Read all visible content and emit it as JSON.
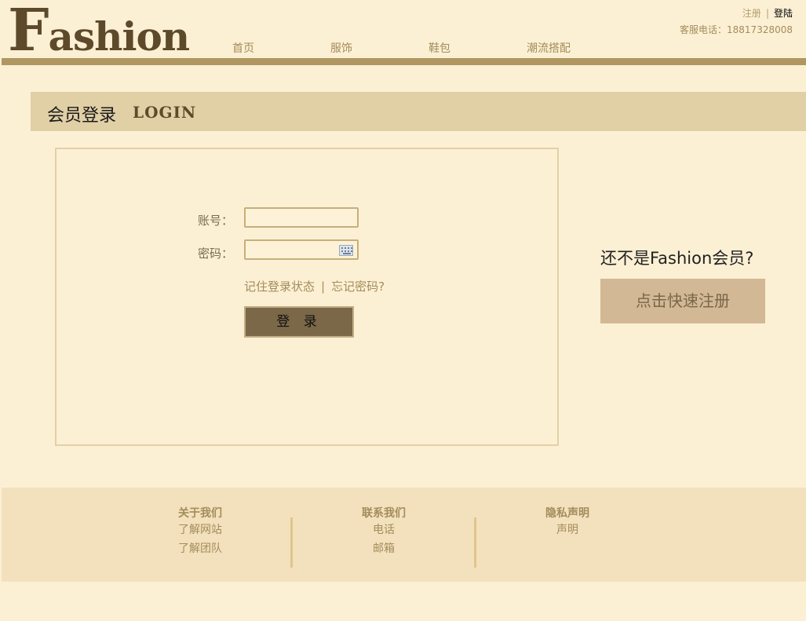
{
  "logo": {
    "initial": "F",
    "rest": "ashion"
  },
  "nav": {
    "items": [
      {
        "label": "首页"
      },
      {
        "label": "服饰"
      },
      {
        "label": "鞋包"
      },
      {
        "label": "潮流搭配"
      }
    ]
  },
  "top_links": {
    "register": "注册",
    "separator": "|",
    "login": "登陆",
    "hotline": "客服电话：18817328008"
  },
  "title_bar": {
    "cn": "会员登录",
    "en": "LOGIN"
  },
  "login_form": {
    "account_label": "账号：",
    "account_value": "",
    "password_label": "密码：",
    "password_value": "",
    "remember": "记住登录状态",
    "separator": "|",
    "forgot": "忘记密码?",
    "submit": "登 录"
  },
  "register_prompt": {
    "question": "还不是Fashion会员?",
    "button": "点击快速注册"
  },
  "footer": {
    "columns": [
      {
        "heading": "关于我们",
        "items": [
          "了解网站",
          "了解团队"
        ]
      },
      {
        "heading": "联系我们",
        "items": [
          "电话",
          "邮箱"
        ]
      },
      {
        "heading": "隐私声明",
        "items": [
          "声明"
        ]
      }
    ]
  },
  "colors": {
    "background": "#fcf0d4",
    "brand_brown": "#5d4a2a",
    "accent_tan": "#a38c5b",
    "header_bar": "#b09660",
    "title_bar": "#e1cfa6",
    "footer": "#f3e1bd",
    "login_button": "#7a6848",
    "register_button": "#d2b895"
  },
  "icons": {
    "password_field": "keyboard-icon"
  }
}
